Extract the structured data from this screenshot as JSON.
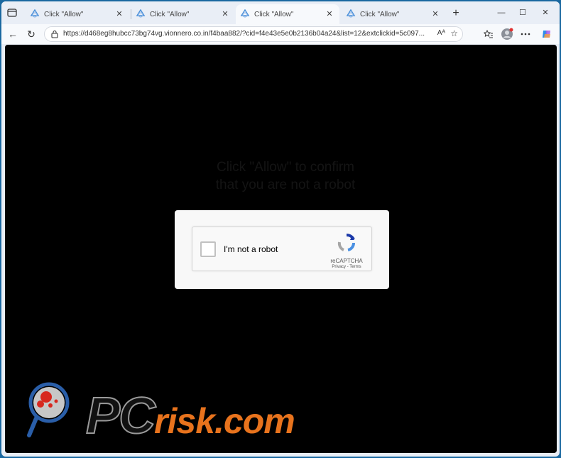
{
  "tabs": [
    {
      "title": "Click \"Allow\"",
      "active": false
    },
    {
      "title": "Click \"Allow\"",
      "active": false
    },
    {
      "title": "Click \"Allow\"",
      "active": true
    },
    {
      "title": "Click \"Allow\"",
      "active": false
    }
  ],
  "toolbar": {
    "url": "https://d468eg8hubcc73bg74vg.vionnero.co.in/f4baa882/?cid=f4e43e5e0b2136b04a24&list=12&extclickid=5c097...",
    "read_aloud": "Aᴬ"
  },
  "page": {
    "headline_line1": "Click \"Allow\" to confirm",
    "headline_line2": "that you are not a robot"
  },
  "captcha": {
    "label": "I'm not a robot",
    "brand": "reCAPTCHA",
    "links": "Privacy - Terms"
  },
  "watermark": {
    "pc": "PC",
    "risk": "risk.com"
  }
}
